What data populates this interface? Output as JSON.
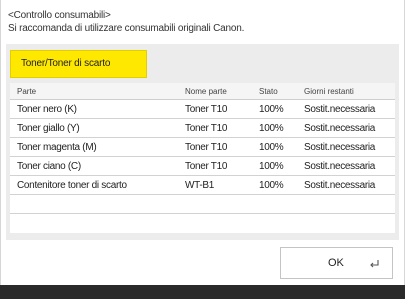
{
  "header": {
    "title": "<Controllo consumabili>",
    "message": "Si raccomanda di utilizzare consumabili originali Canon."
  },
  "tab": {
    "label": "Toner/Toner di scarto"
  },
  "table": {
    "columns": [
      "Parte",
      "Nome parte",
      "Stato",
      "Giorni restanti"
    ],
    "rows": [
      [
        "Toner nero (K)",
        "Toner T10",
        "100%",
        "Sostit.necessaria"
      ],
      [
        "Toner giallo (Y)",
        "Toner T10",
        "100%",
        "Sostit.necessaria"
      ],
      [
        "Toner magenta (M)",
        "Toner T10",
        "100%",
        "Sostit.necessaria"
      ],
      [
        "Toner ciano (C)",
        "Toner T10",
        "100%",
        "Sostit.necessaria"
      ],
      [
        "Contenitore toner di scarto",
        "WT-B1",
        "100%",
        "Sostit.necessaria"
      ]
    ]
  },
  "ok_button": {
    "label": "OK",
    "icon": "enter-icon"
  },
  "colors": {
    "tab_highlight": "#ffe800",
    "panel_bg": "#ececec",
    "footer_bar": "#2a2a2a"
  }
}
